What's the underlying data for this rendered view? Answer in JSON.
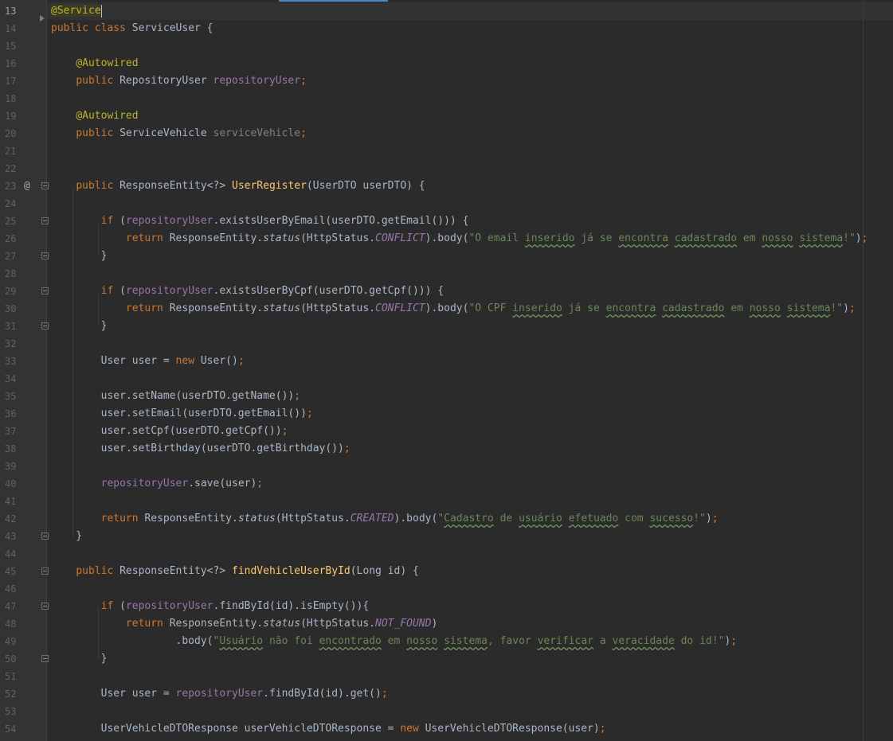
{
  "editor": {
    "current_line": "13",
    "gutter_icons": {
      "override_marker": "@"
    },
    "lines": [
      {
        "n": "13",
        "tokens": [
          [
            "ann-hl ann",
            "@Service"
          ]
        ],
        "caret": true
      },
      {
        "n": "14",
        "tokens": [
          [
            "kw",
            "public class "
          ],
          [
            "",
            "ServiceUser {"
          ]
        ]
      },
      {
        "n": "15",
        "tokens": []
      },
      {
        "n": "16",
        "tokens": [
          [
            "",
            "    "
          ],
          [
            "ann",
            "@Autowired"
          ]
        ]
      },
      {
        "n": "17",
        "tokens": [
          [
            "",
            "    "
          ],
          [
            "kw",
            "public "
          ],
          [
            "",
            "RepositoryUser "
          ],
          [
            "fld",
            "repositoryUser"
          ],
          [
            "kw",
            ";"
          ]
        ]
      },
      {
        "n": "18",
        "tokens": []
      },
      {
        "n": "19",
        "tokens": [
          [
            "",
            "    "
          ],
          [
            "ann",
            "@Autowired"
          ]
        ]
      },
      {
        "n": "20",
        "tokens": [
          [
            "",
            "    "
          ],
          [
            "kw",
            "public "
          ],
          [
            "",
            "ServiceVehicle "
          ],
          [
            "fld-unused",
            "serviceVehicle"
          ],
          [
            "kw",
            ";"
          ]
        ]
      },
      {
        "n": "21",
        "tokens": []
      },
      {
        "n": "22",
        "tokens": []
      },
      {
        "n": "23",
        "tokens": [
          [
            "",
            "    "
          ],
          [
            "kw",
            "public "
          ],
          [
            "",
            "ResponseEntity<?> "
          ],
          [
            "mth",
            "UserRegister"
          ],
          [
            "",
            "(UserDTO userDTO) {"
          ]
        ]
      },
      {
        "n": "24",
        "tokens": []
      },
      {
        "n": "25",
        "tokens": [
          [
            "",
            "        "
          ],
          [
            "kw",
            "if "
          ],
          [
            "",
            "("
          ],
          [
            "fld",
            "repositoryUser"
          ],
          [
            "",
            ".existsUserByEmail(userDTO.getEmail())) {"
          ]
        ]
      },
      {
        "n": "26",
        "tokens": [
          [
            "",
            "            "
          ],
          [
            "kw",
            "return "
          ],
          [
            "",
            "ResponseEntity."
          ],
          [
            "stat",
            "status"
          ],
          [
            "",
            "(HttpStatus."
          ],
          [
            "const",
            "CONFLICT"
          ],
          [
            "",
            ").body("
          ],
          [
            "str",
            "\"O email "
          ],
          [
            "str typo",
            "inserido"
          ],
          [
            "str",
            " já se "
          ],
          [
            "str typo",
            "encontra"
          ],
          [
            "str",
            " "
          ],
          [
            "str typo",
            "cadastrado"
          ],
          [
            "str",
            " em "
          ],
          [
            "str typo",
            "nosso"
          ],
          [
            "str",
            " "
          ],
          [
            "str typo",
            "sistema"
          ],
          [
            "str",
            "!\""
          ],
          [
            "",
            ")"
          ],
          [
            "kw",
            ";"
          ]
        ]
      },
      {
        "n": "27",
        "tokens": [
          [
            "",
            "        }"
          ]
        ]
      },
      {
        "n": "28",
        "tokens": []
      },
      {
        "n": "29",
        "tokens": [
          [
            "",
            "        "
          ],
          [
            "kw",
            "if "
          ],
          [
            "",
            "("
          ],
          [
            "fld",
            "repositoryUser"
          ],
          [
            "",
            ".existsUserByCpf(userDTO.getCpf())) {"
          ]
        ]
      },
      {
        "n": "30",
        "tokens": [
          [
            "",
            "            "
          ],
          [
            "kw",
            "return "
          ],
          [
            "",
            "ResponseEntity."
          ],
          [
            "stat",
            "status"
          ],
          [
            "",
            "(HttpStatus."
          ],
          [
            "const",
            "CONFLICT"
          ],
          [
            "",
            ").body("
          ],
          [
            "str",
            "\"O CPF "
          ],
          [
            "str typo",
            "inserido"
          ],
          [
            "str",
            " já se "
          ],
          [
            "str typo",
            "encontra"
          ],
          [
            "str",
            " "
          ],
          [
            "str typo",
            "cadastrado"
          ],
          [
            "str",
            " em "
          ],
          [
            "str typo",
            "nosso"
          ],
          [
            "str",
            " "
          ],
          [
            "str typo",
            "sistema"
          ],
          [
            "str",
            "!\""
          ],
          [
            "",
            ")"
          ],
          [
            "kw",
            ";"
          ]
        ]
      },
      {
        "n": "31",
        "tokens": [
          [
            "",
            "        }"
          ]
        ]
      },
      {
        "n": "32",
        "tokens": []
      },
      {
        "n": "33",
        "tokens": [
          [
            "",
            "        User user = "
          ],
          [
            "kw",
            "new "
          ],
          [
            "",
            "User()"
          ],
          [
            "kw",
            ";"
          ]
        ]
      },
      {
        "n": "34",
        "tokens": []
      },
      {
        "n": "35",
        "tokens": [
          [
            "",
            "        user.setName(userDTO.getName())"
          ],
          [
            "kw",
            ";"
          ]
        ]
      },
      {
        "n": "36",
        "tokens": [
          [
            "",
            "        user.setEmail(userDTO.getEmail())"
          ],
          [
            "kw",
            ";"
          ]
        ]
      },
      {
        "n": "37",
        "tokens": [
          [
            "",
            "        user.setCpf(userDTO.getCpf())"
          ],
          [
            "kw",
            ";"
          ]
        ]
      },
      {
        "n": "38",
        "tokens": [
          [
            "",
            "        user.setBirthday(userDTO.getBirthday())"
          ],
          [
            "kw",
            ";"
          ]
        ]
      },
      {
        "n": "39",
        "tokens": []
      },
      {
        "n": "40",
        "tokens": [
          [
            "",
            "        "
          ],
          [
            "fld",
            "repositoryUser"
          ],
          [
            "",
            ".save(user)"
          ],
          [
            "kw",
            ";"
          ]
        ]
      },
      {
        "n": "41",
        "tokens": []
      },
      {
        "n": "42",
        "tokens": [
          [
            "",
            "        "
          ],
          [
            "kw",
            "return "
          ],
          [
            "",
            "ResponseEntity."
          ],
          [
            "stat",
            "status"
          ],
          [
            "",
            "(HttpStatus."
          ],
          [
            "const",
            "CREATED"
          ],
          [
            "",
            ").body("
          ],
          [
            "str",
            "\""
          ],
          [
            "str typo",
            "Cadastro"
          ],
          [
            "str",
            " de "
          ],
          [
            "str typo",
            "usuário"
          ],
          [
            "str",
            " "
          ],
          [
            "str typo",
            "efetuado"
          ],
          [
            "str",
            " com "
          ],
          [
            "str typo",
            "sucesso"
          ],
          [
            "str",
            "!\""
          ],
          [
            "",
            ")"
          ],
          [
            "kw",
            ";"
          ]
        ]
      },
      {
        "n": "43",
        "tokens": [
          [
            "",
            "    }"
          ]
        ]
      },
      {
        "n": "44",
        "tokens": []
      },
      {
        "n": "45",
        "tokens": [
          [
            "",
            "    "
          ],
          [
            "kw",
            "public "
          ],
          [
            "",
            "ResponseEntity<?> "
          ],
          [
            "mth",
            "findVehicleUserById"
          ],
          [
            "",
            "(Long id) {"
          ]
        ]
      },
      {
        "n": "46",
        "tokens": []
      },
      {
        "n": "47",
        "tokens": [
          [
            "",
            "        "
          ],
          [
            "kw",
            "if "
          ],
          [
            "",
            "("
          ],
          [
            "fld",
            "repositoryUser"
          ],
          [
            "",
            ".findById(id).isEmpty()){"
          ]
        ]
      },
      {
        "n": "48",
        "tokens": [
          [
            "",
            "            "
          ],
          [
            "kw",
            "return "
          ],
          [
            "",
            "ResponseEntity."
          ],
          [
            "stat",
            "status"
          ],
          [
            "",
            "(HttpStatus."
          ],
          [
            "const",
            "NOT_FOUND"
          ],
          [
            "",
            ")"
          ]
        ]
      },
      {
        "n": "49",
        "tokens": [
          [
            "",
            "                    .body("
          ],
          [
            "str",
            "\""
          ],
          [
            "str typo",
            "Usuário"
          ],
          [
            "str",
            " não foi "
          ],
          [
            "str typo",
            "encontrado"
          ],
          [
            "str",
            " em "
          ],
          [
            "str typo",
            "nosso"
          ],
          [
            "str",
            " "
          ],
          [
            "str typo",
            "sistema"
          ],
          [
            "str",
            ", favor "
          ],
          [
            "str typo",
            "verificar"
          ],
          [
            "str",
            " a "
          ],
          [
            "str typo",
            "veracidade"
          ],
          [
            "str",
            " do id!\""
          ],
          [
            "",
            ")"
          ],
          [
            "kw",
            ";"
          ]
        ]
      },
      {
        "n": "50",
        "tokens": [
          [
            "",
            "        }"
          ]
        ]
      },
      {
        "n": "51",
        "tokens": []
      },
      {
        "n": "52",
        "tokens": [
          [
            "",
            "        User user = "
          ],
          [
            "fld",
            "repositoryUser"
          ],
          [
            "",
            ".findById(id).get()"
          ],
          [
            "kw",
            ";"
          ]
        ]
      },
      {
        "n": "53",
        "tokens": []
      },
      {
        "n": "54",
        "tokens": [
          [
            "",
            "        UserVehicleDTOResponse userVehicleDTOResponse = "
          ],
          [
            "kw",
            "new "
          ],
          [
            "",
            "UserVehicleDTOResponse(user)"
          ],
          [
            "kw",
            ";"
          ]
        ]
      }
    ]
  }
}
